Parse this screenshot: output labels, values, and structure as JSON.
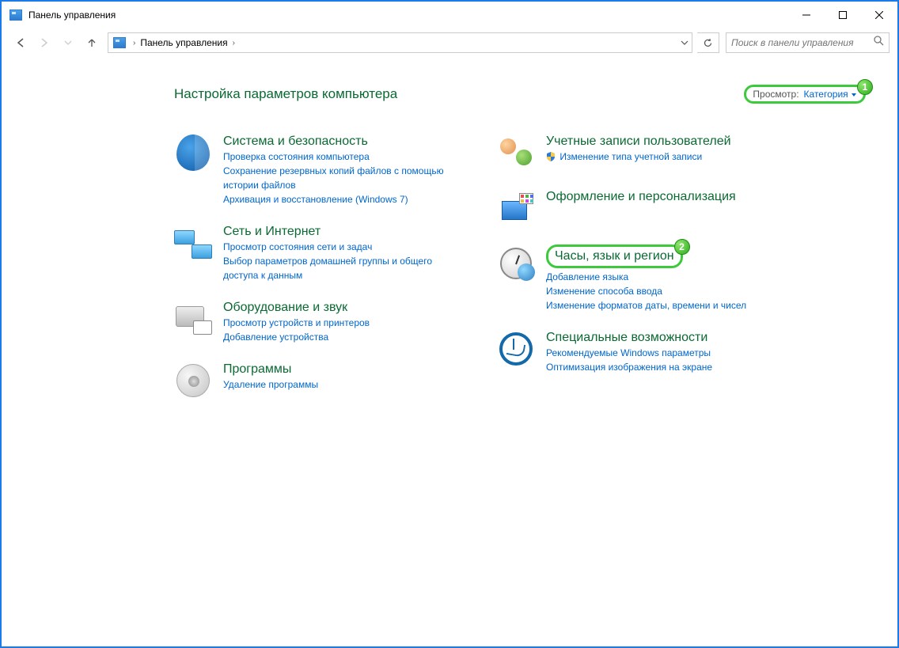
{
  "window": {
    "title": "Панель управления"
  },
  "nav": {
    "breadcrumb": "Панель управления",
    "search_placeholder": "Поиск в панели управления"
  },
  "page_heading": "Настройка параметров компьютера",
  "view_by": {
    "label": "Просмотр:",
    "value": "Категория"
  },
  "annotations": {
    "one": "1",
    "two": "2"
  },
  "left": [
    {
      "title": "Система и безопасность",
      "links": [
        "Проверка состояния компьютера",
        "Сохранение резервных копий файлов с помощью истории файлов",
        "Архивация и восстановление (Windows 7)"
      ]
    },
    {
      "title": "Сеть и Интернет",
      "links": [
        "Просмотр состояния сети и задач",
        "Выбор параметров домашней группы и общего доступа к данным"
      ]
    },
    {
      "title": "Оборудование и звук",
      "links": [
        "Просмотр устройств и принтеров",
        "Добавление устройства"
      ]
    },
    {
      "title": "Программы",
      "links": [
        "Удаление программы"
      ]
    }
  ],
  "right": [
    {
      "title": "Учетные записи пользователей",
      "links": [
        "Изменение типа учетной записи"
      ],
      "shielded": [
        true
      ]
    },
    {
      "title": "Оформление и персонализация",
      "links": []
    },
    {
      "title": "Часы, язык и регион",
      "links": [
        "Добавление языка",
        "Изменение способа ввода",
        "Изменение форматов даты, времени и чисел"
      ]
    },
    {
      "title": "Специальные возможности",
      "links": [
        "Рекомендуемые Windows параметры",
        "Оптимизация изображения на экране"
      ]
    }
  ]
}
